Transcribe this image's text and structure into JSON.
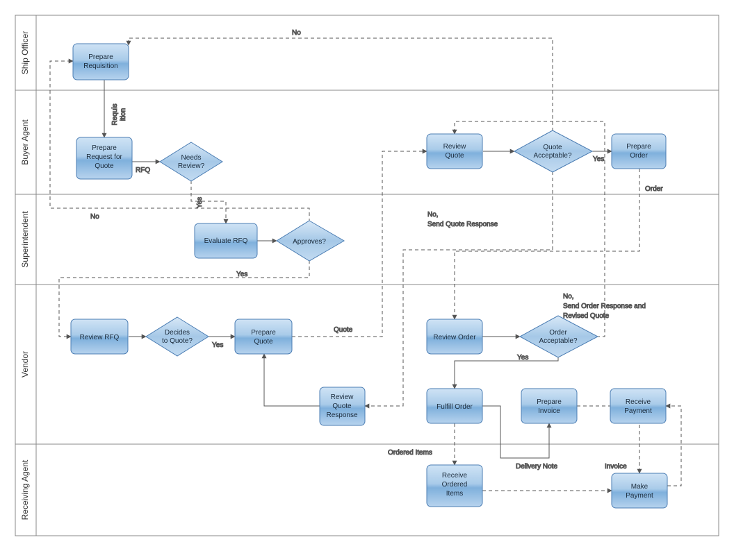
{
  "lanes": {
    "ship_officer": "Ship Officer",
    "buyer_agent": "Buyer Agent",
    "superintendent": "Superintendent",
    "vendor": "Vendor",
    "receiving_agent": "Receiving Agent"
  },
  "nodes": {
    "prepare_requisition": {
      "l1": "Prepare",
      "l2": "Requisition"
    },
    "prepare_rfq": {
      "l1": "Prepare",
      "l2": "Request for",
      "l3": "Quote"
    },
    "needs_review": {
      "l1": "Needs",
      "l2": "Review?"
    },
    "evaluate_rfq": {
      "l1": "Evaluate RFQ"
    },
    "approves": {
      "l1": "Approves?"
    },
    "review_rfq": {
      "l1": "Review RFQ"
    },
    "decides_quote": {
      "l1": "Decides",
      "l2": "to Quote?"
    },
    "prepare_quote": {
      "l1": "Prepare",
      "l2": "Quote"
    },
    "review_quote": {
      "l1": "Review",
      "l2": "Quote"
    },
    "quote_acceptable": {
      "l1": "Quote",
      "l2": "Acceptable?"
    },
    "prepare_order": {
      "l1": "Prepare",
      "l2": "Order"
    },
    "review_order": {
      "l1": "Review Order"
    },
    "order_acceptable": {
      "l1": "Order",
      "l2": "Acceptable?"
    },
    "review_quote_response": {
      "l1": "Review",
      "l2": "Quote",
      "l3": "Response"
    },
    "fulfill_order": {
      "l1": "Fulfill Order"
    },
    "prepare_invoice": {
      "l1": "Prepare",
      "l2": "Invoice"
    },
    "receive_payment": {
      "l1": "Receive",
      "l2": "Payment"
    },
    "receive_items": {
      "l1": "Receive",
      "l2": "Ordered",
      "l3": "Items"
    },
    "make_payment": {
      "l1": "Make",
      "l2": "Payment"
    }
  },
  "edges": {
    "no_top": "No",
    "requisition": "Requis\nition",
    "rfq": "RFQ",
    "yes_needs": "Yes",
    "no_approves": "No",
    "yes_approves": "Yes",
    "yes_decides": "Yes",
    "quote": "Quote",
    "yes_quote_acc": "Yes",
    "no_quote_acc": {
      "l1": "No,",
      "l2": "Send Quote Response"
    },
    "order": "Order",
    "yes_order_acc": "Yes",
    "no_order_acc": {
      "l1": "No,",
      "l2": "Send Order Response and",
      "l3": "Revised Quote"
    },
    "ordered_items": "Ordered Items",
    "delivery_note": "Delivery Note",
    "invoice": "Invoice"
  }
}
